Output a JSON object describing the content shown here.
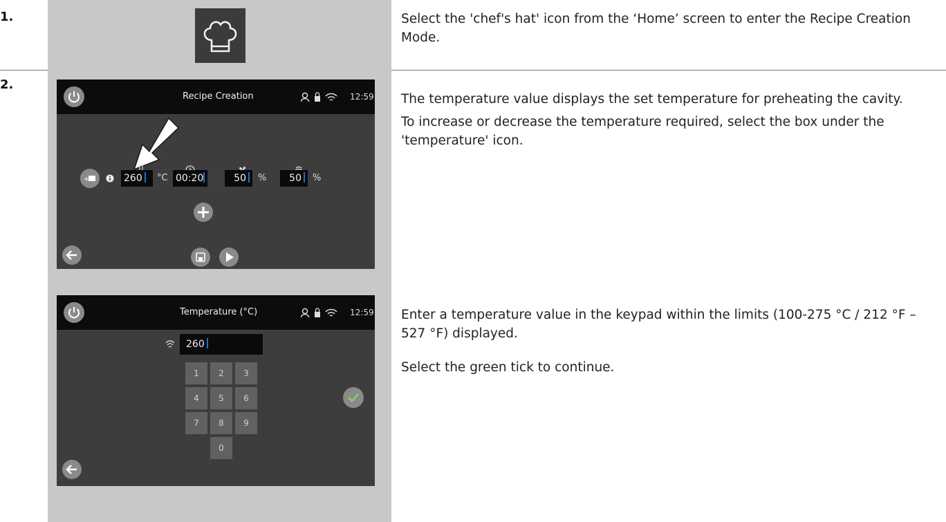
{
  "steps": [
    {
      "number": "1.",
      "text": [
        "Select the 'chef's hat' icon from the ‘Home’ screen to enter the Recipe Creation Mode."
      ]
    },
    {
      "number": "2.",
      "text_a": [
        "The temperature value displays the set temperature for preheating the cavity.",
        "To increase or decrease the temperature required, select the box under the 'temperature' icon."
      ],
      "text_b": [
        "Enter a temperature value in the keypad within the limits (100-275 °C / 212 °F – 527 °F) displayed.",
        "Select the green tick to continue."
      ]
    }
  ],
  "screen1": {
    "title": "Recipe Creation",
    "time": "12:59",
    "temperature": "260",
    "temperature_unit": "°C",
    "time_value": "00:20",
    "fan": "50",
    "fan_unit": "%",
    "humidity": "50",
    "humidity_unit": "%"
  },
  "screen2": {
    "title": "Temperature (°C)",
    "time": "12:59",
    "input_value": "260",
    "keys": [
      "1",
      "2",
      "3",
      "4",
      "5",
      "6",
      "7",
      "8",
      "9",
      "0"
    ]
  },
  "colors": {
    "accent_cursor": "#1f6fd1",
    "tick_green": "#7ed957",
    "screen_bg": "#3d3d3d",
    "top_bar": "#0c0c0c"
  },
  "icons": [
    "chef-hat-icon",
    "power-icon",
    "person-icon",
    "lock-icon",
    "wifi-icon",
    "thermometer-icon",
    "clock-icon",
    "fan-icon",
    "humidity-icon",
    "add-step-icon",
    "info-icon",
    "plus-icon",
    "back-arrow-icon",
    "save-icon",
    "play-icon",
    "pointer-arrow-icon",
    "check-icon"
  ]
}
